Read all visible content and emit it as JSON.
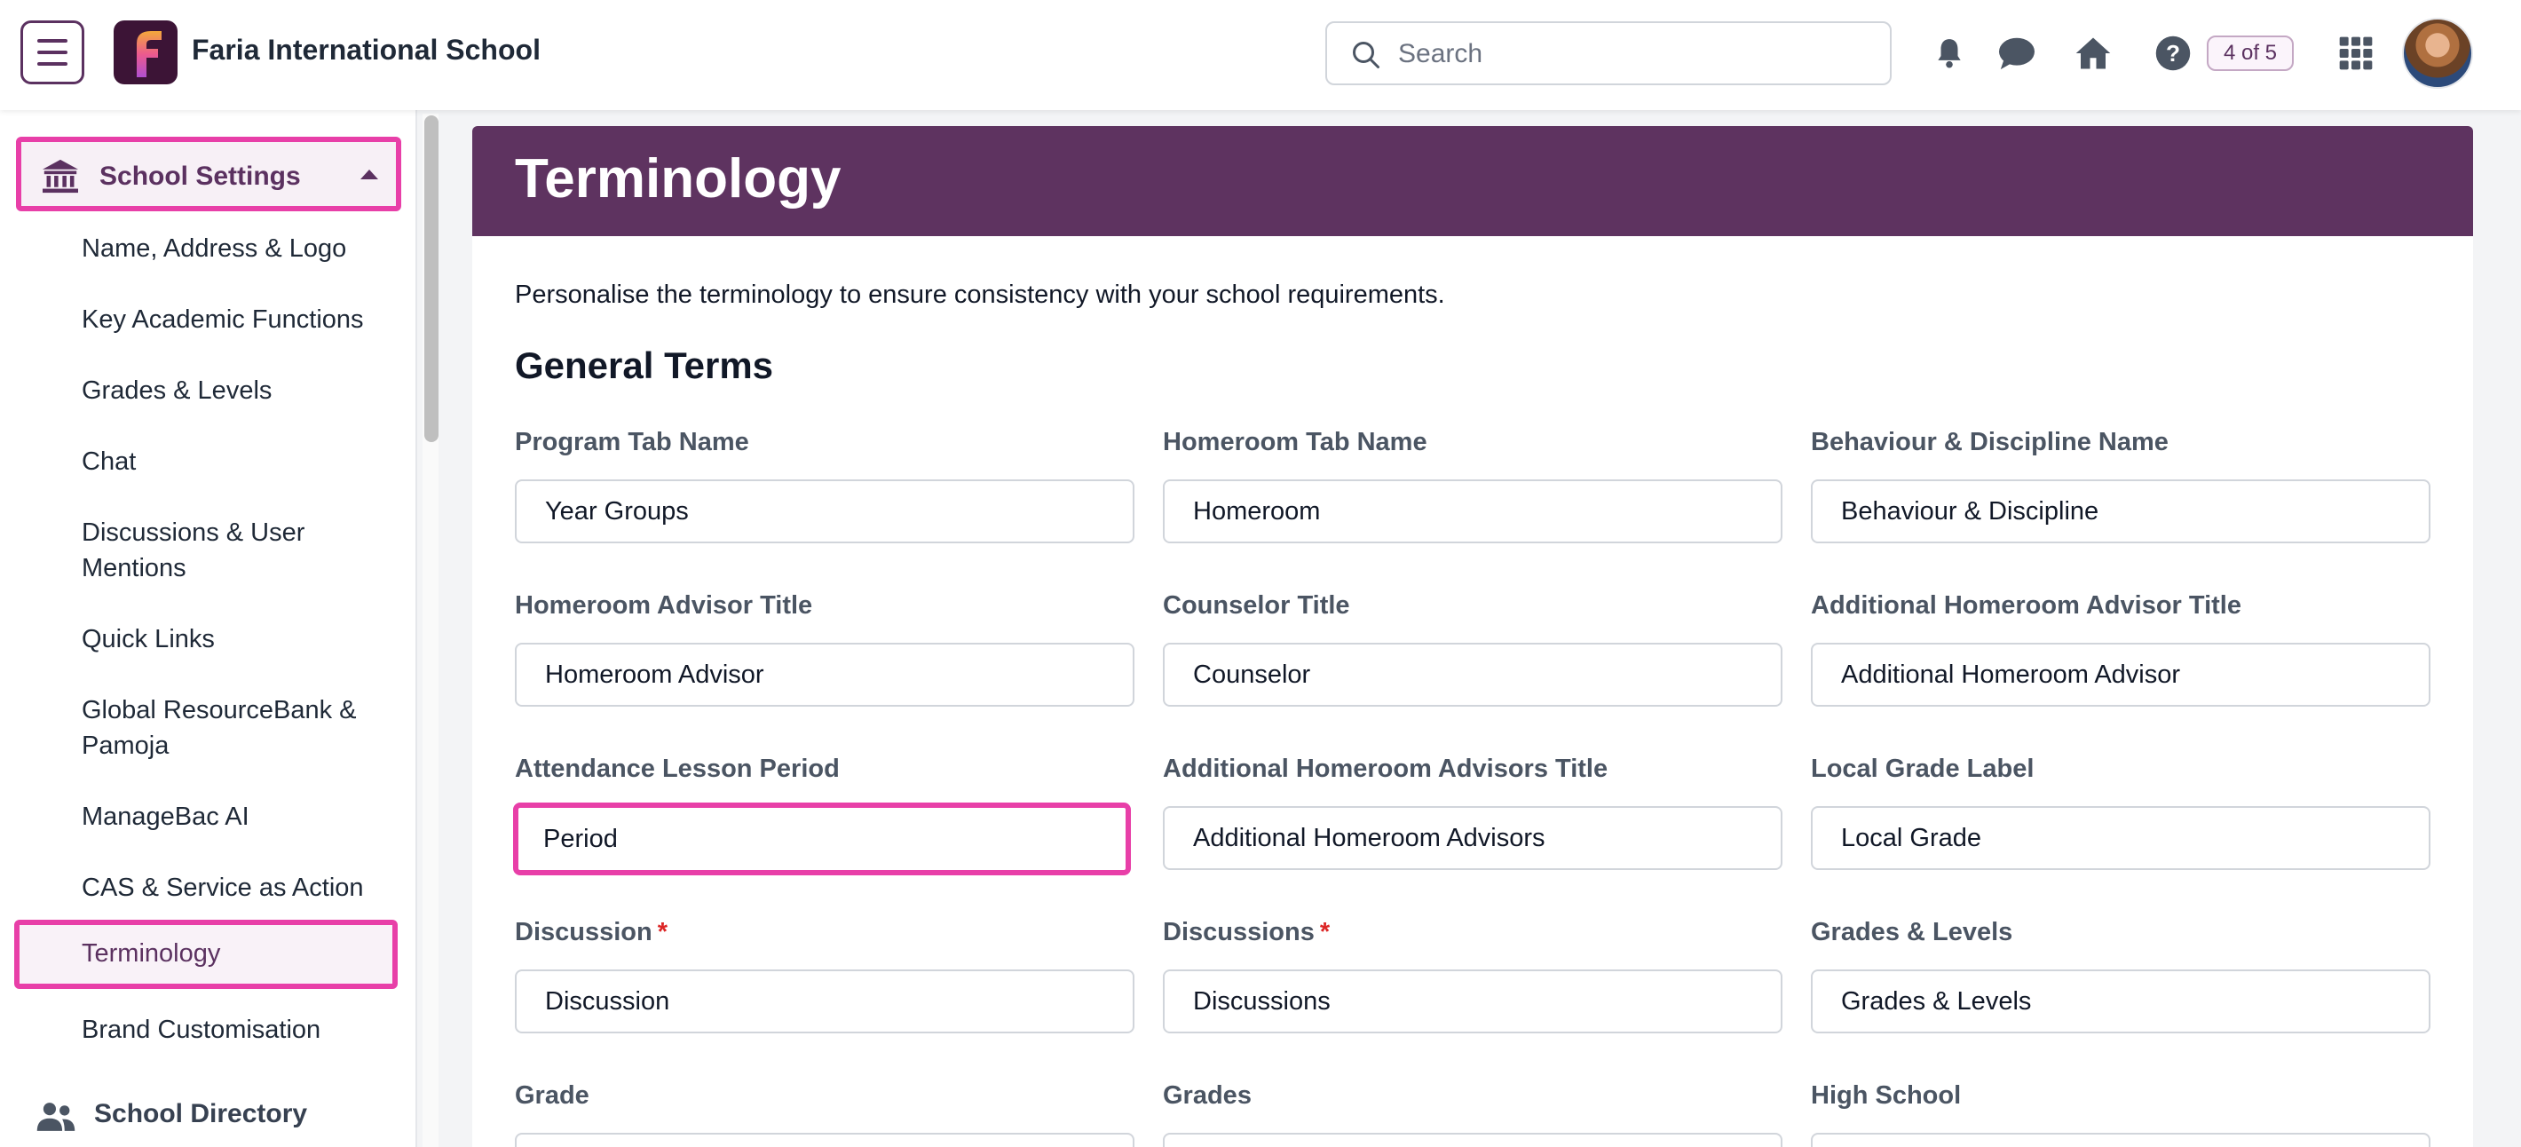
{
  "header": {
    "school_name": "Faria International School",
    "search_placeholder": "Search",
    "badge": "4 of 5"
  },
  "sidebar": {
    "section_title": "School Settings",
    "items": [
      {
        "label": "Name, Address & Logo"
      },
      {
        "label": "Key Academic Functions"
      },
      {
        "label": "Grades & Levels"
      },
      {
        "label": "Chat"
      },
      {
        "label": "Discussions & User Mentions"
      },
      {
        "label": "Quick Links"
      },
      {
        "label": "Global ResourceBank & Pamoja"
      },
      {
        "label": "ManageBac AI"
      },
      {
        "label": "CAS & Service as Action"
      },
      {
        "label": "Terminology"
      },
      {
        "label": "Brand Customisation"
      }
    ],
    "active_item": "Terminology",
    "next_section": "School Directory"
  },
  "main": {
    "title": "Terminology",
    "intro": "Personalise the terminology to ensure consistency with your school requirements.",
    "section_title": "General Terms",
    "fields": [
      {
        "label": "Program Tab Name",
        "value": "Year Groups"
      },
      {
        "label": "Homeroom Tab Name",
        "value": "Homeroom"
      },
      {
        "label": "Behaviour & Discipline Name",
        "value": "Behaviour & Discipline"
      },
      {
        "label": "Homeroom Advisor Title",
        "value": "Homeroom Advisor"
      },
      {
        "label": "Counselor Title",
        "value": "Counselor"
      },
      {
        "label": "Additional Homeroom Advisor Title",
        "value": "Additional Homeroom Advisor"
      },
      {
        "label": "Attendance Lesson Period",
        "value": "Period"
      },
      {
        "label": "Additional Homeroom Advisors Title",
        "value": "Additional Homeroom Advisors"
      },
      {
        "label": "Local Grade Label",
        "value": "Local Grade"
      },
      {
        "label": "Discussion",
        "value": "Discussion",
        "required_mark": "*"
      },
      {
        "label": "Discussions",
        "value": "Discussions",
        "required_mark": "*"
      },
      {
        "label": "Grades & Levels",
        "value": "Grades & Levels"
      },
      {
        "label": "Grade",
        "value": ""
      },
      {
        "label": "Grades",
        "value": ""
      },
      {
        "label": "High School",
        "value": ""
      }
    ]
  },
  "colors": {
    "brand_purple": "#5e3360",
    "highlight_pink": "#e83fa8",
    "required_red": "#dc2626"
  },
  "icons": [
    "menu-icon",
    "app-logo",
    "search-icon",
    "bell-icon",
    "chat-icon",
    "home-icon",
    "help-icon",
    "apps-grid-icon",
    "bank-icon",
    "caret-up-icon",
    "people-icon"
  ]
}
